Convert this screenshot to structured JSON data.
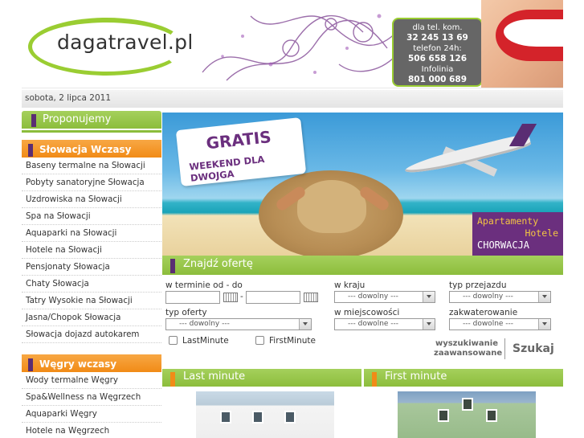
{
  "header": {
    "logo_text": "dagatravel.pl",
    "contact": [
      {
        "label": "dla tel. kom.",
        "value": "32 245 13 69"
      },
      {
        "label": "telefon 24h:",
        "value": "506 658 126"
      },
      {
        "label": "Infolinia",
        "value": "801 000 689"
      }
    ]
  },
  "date": "sobota, 2 lipca 2011",
  "sidebar": {
    "title": "Proponujemy",
    "sections": [
      {
        "title": "Słowacja Wczasy",
        "items": [
          "Baseny termalne na Słowacji",
          "Pobyty sanatoryjne Słowacja",
          "Uzdrowiska na Słowacji",
          "Spa na Słowacji",
          "Aquaparki na Słowacji",
          "Hotele na Słowacji",
          "Pensjonaty Słowacja",
          "Chaty Słowacja",
          "Tatry Wysokie na Słowacji",
          "Jasna/Chopok Słowacja",
          "Słowacja dojazd autokarem"
        ]
      },
      {
        "title": "Węgry wczasy",
        "items": [
          "Wody termalne Węgry",
          "Spa&Wellness na Węgrzech",
          "Aquaparki Węgry",
          "Hotele na Węgrzech"
        ]
      }
    ]
  },
  "banner": {
    "tag_line1": "GRATIS",
    "tag_line2": "WEEKEND DLA DWOJGA",
    "promo_line1": "Apartamenty",
    "promo_line2": "Hotele",
    "promo_line3": "CHORWACJA"
  },
  "search": {
    "title": "Znajdź ofertę",
    "date_label": "w terminie od - do",
    "date_sep": "-",
    "date_from": "",
    "date_to": "",
    "country_label": "w kraju",
    "country_value": "--- dowolny ---",
    "travel_label": "typ przejazdu",
    "travel_value": "--- dowolny ---",
    "offer_label": "typ oferty",
    "offer_value": "--- dowolny ---",
    "city_label": "w miejscowości",
    "city_value": "--- dowolne ---",
    "accom_label": "zakwaterowanie",
    "accom_value": "--- dowolne ---",
    "lastminute_label": "LastMinute",
    "firstminute_label": "FirstMinute",
    "advanced_line1": "wyszukiwanie",
    "advanced_line2": "zaawansowane",
    "search_button": "Szukaj"
  },
  "boxes": {
    "last_minute": "Last minute",
    "first_minute": "First minute"
  },
  "colors": {
    "green": "#8cbd3c",
    "orange": "#f18b17",
    "purple": "#5a2d73"
  }
}
